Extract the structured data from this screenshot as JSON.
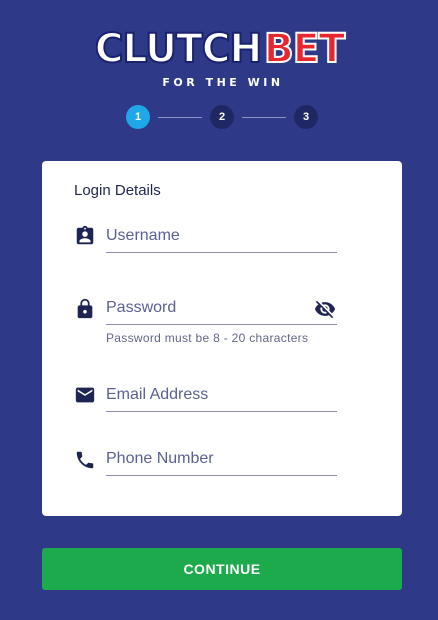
{
  "brand": {
    "word_primary": "CLUTCH",
    "word_accent": "BET",
    "tagline": "FOR THE WIN",
    "accent_color": "#e8262e",
    "background_color": "#2e3a87"
  },
  "stepper": {
    "steps": [
      "1",
      "2",
      "3"
    ],
    "active_step": "1",
    "active_color": "#1fa8e8"
  },
  "form": {
    "title": "Login Details",
    "fields": {
      "username": {
        "placeholder": "Username",
        "value": "",
        "icon": "account-badge-icon"
      },
      "password": {
        "placeholder": "Password",
        "value": "",
        "hint": "Password must be 8 - 20 characters",
        "icon": "lock-icon",
        "toggle_icon": "eye-off-icon"
      },
      "email": {
        "placeholder": "Email Address",
        "value": "",
        "icon": "mail-icon"
      },
      "phone": {
        "placeholder": "Phone Number",
        "value": "",
        "icon": "phone-icon"
      }
    }
  },
  "actions": {
    "continue_label": "CONTINUE",
    "continue_color": "#1daa4c"
  }
}
